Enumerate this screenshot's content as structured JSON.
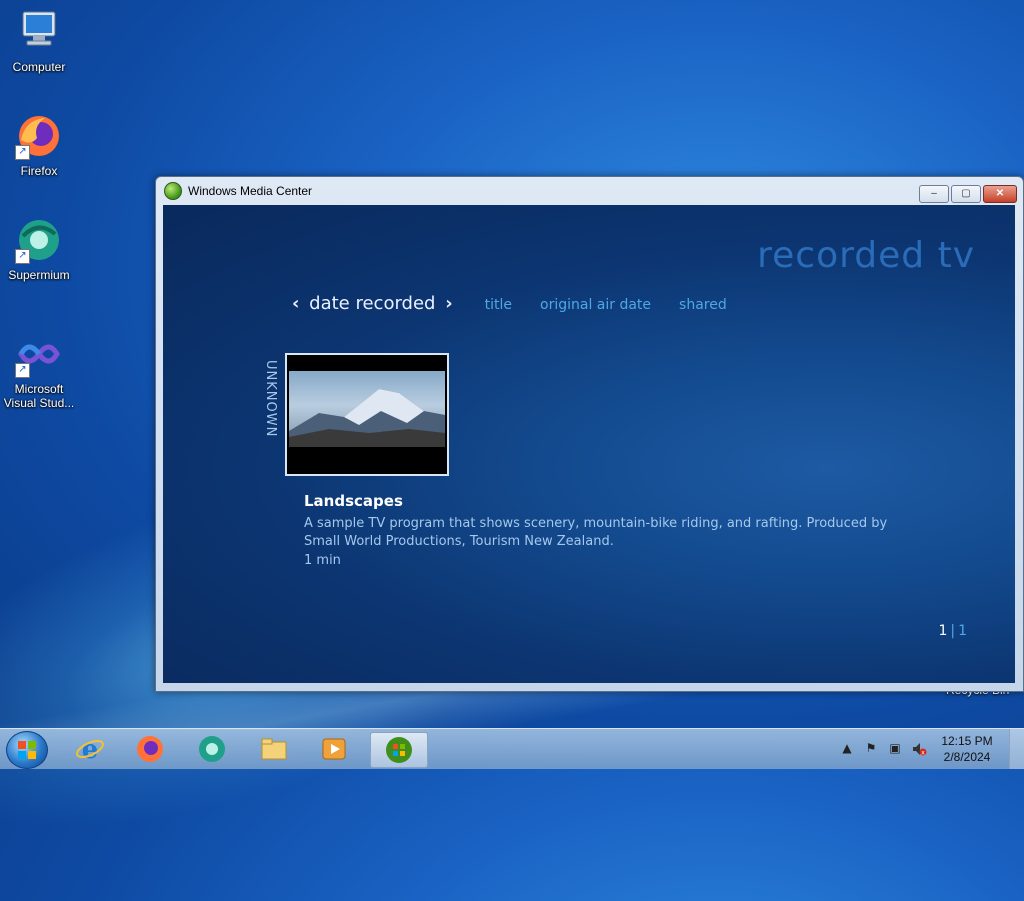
{
  "desktop": {
    "icons": [
      {
        "label": "Computer",
        "icon": "computer-icon"
      },
      {
        "label": "Firefox",
        "icon": "firefox-icon"
      },
      {
        "label": "Supermium",
        "icon": "supermium-icon"
      },
      {
        "label": "Microsoft Visual Stud...",
        "icon": "visual-studio-icon"
      }
    ],
    "recycle_bin_label": "Recycle Bin"
  },
  "window": {
    "title": "Windows Media Center",
    "buttons": {
      "minimize": "–",
      "restore": "▢",
      "close": "✕"
    }
  },
  "media_center": {
    "section_title": "recorded tv",
    "sort_tabs": {
      "current": "date recorded",
      "chevron_left": "‹",
      "chevron_right": "›",
      "others": [
        "title",
        "original air date",
        "shared"
      ]
    },
    "group_label": "UNKNOWN",
    "selected_item": {
      "title": "Landscapes",
      "description": "A sample TV program that shows scenery, mountain-bike riding, and rafting. Produced by Small World Productions, Tourism New Zealand.",
      "duration": "1 min"
    },
    "pager": {
      "current": "1",
      "separator": "|",
      "total": "1"
    }
  },
  "taskbar": {
    "pinned": [
      "internet-explorer-icon",
      "firefox-icon",
      "supermium-icon",
      "file-explorer-icon",
      "media-player-icon",
      "media-center-icon"
    ],
    "tray_icons": [
      "show-hidden-icons-arrow",
      "action-center-flag-icon",
      "network-icon",
      "volume-muted-icon"
    ],
    "time": "12:15 PM",
    "date": "2/8/2024"
  },
  "colors": {
    "wmc_background": "#0c3571",
    "accent_blue": "#4fa7e6",
    "desktop_blue": "#1a63c4"
  }
}
